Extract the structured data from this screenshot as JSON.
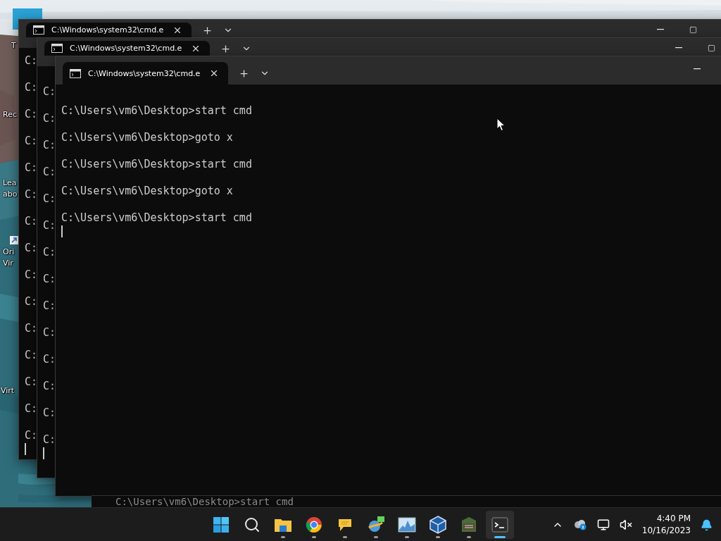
{
  "desktop": {
    "icons": [
      {
        "lines": [
          "T"
        ]
      },
      {
        "lines": [
          "Rec"
        ]
      },
      {
        "lines": [
          "Lea",
          "abo"
        ]
      },
      {
        "lines": [
          "Ori",
          "Vir"
        ]
      },
      {
        "lines": [
          "Virt"
        ]
      }
    ]
  },
  "windows": [
    {
      "tab_title": "C:\\Windows\\system32\\cmd.e",
      "lines": [
        "C:",
        "C:",
        "C:",
        "C:",
        "C:",
        "C:",
        "C:",
        "C:",
        "C:",
        "C:",
        "C:",
        "C:",
        "C:",
        "C:",
        "C:"
      ],
      "cursor": true
    },
    {
      "tab_title": "C:\\Windows\\system32\\cmd.e",
      "lines": [
        "C:",
        "C:",
        "C:",
        "C:",
        "C:",
        "C:",
        "C:",
        "C:",
        "C:",
        "C:",
        "C:",
        "C:",
        "C:",
        "C:"
      ],
      "cursor": true
    },
    {
      "tab_title": "C:\\Windows\\system32\\cmd.e",
      "lines": [
        "C:\\Users\\vm6\\Desktop>start cmd",
        "C:\\Users\\vm6\\Desktop>goto x",
        "C:\\Users\\vm6\\Desktop>start cmd",
        "C:\\Users\\vm6\\Desktop>goto x",
        "C:\\Users\\vm6\\Desktop>start cmd"
      ],
      "cursor": true
    }
  ],
  "background_window": {
    "line": "C:\\Users\\vm6\\Desktop>start cmd"
  },
  "taskbar": {
    "apps": [
      {
        "kind": "start",
        "running": false,
        "selected": false
      },
      {
        "kind": "search",
        "running": false,
        "selected": false
      },
      {
        "kind": "folder",
        "running": true,
        "selected": false
      },
      {
        "kind": "browser",
        "running": true,
        "selected": false
      },
      {
        "kind": "chat",
        "running": true,
        "selected": false
      },
      {
        "kind": "network",
        "running": true,
        "selected": false
      },
      {
        "kind": "monitor",
        "running": true,
        "selected": false
      },
      {
        "kind": "cube",
        "running": true,
        "selected": false
      },
      {
        "kind": "game",
        "running": true,
        "selected": false
      },
      {
        "kind": "terminal",
        "running": true,
        "selected": true
      }
    ],
    "clock": {
      "time": "4:40 PM",
      "date": "10/16/2023"
    }
  }
}
